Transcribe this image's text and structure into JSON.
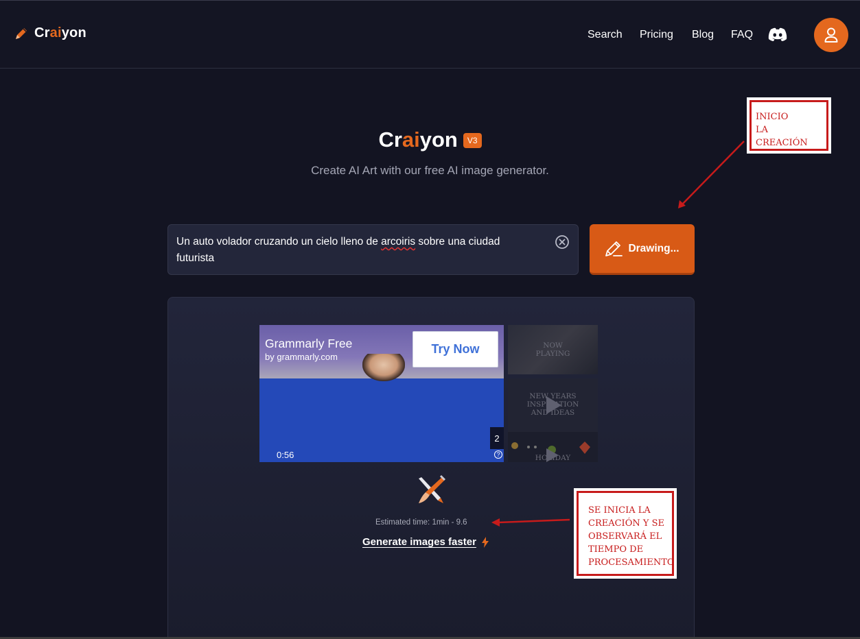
{
  "header": {
    "logo": {
      "prefix": "Cr",
      "highlight": "ai",
      "suffix": "yon"
    },
    "nav": [
      "Search",
      "Pricing",
      "Blog",
      "FAQ"
    ]
  },
  "hero": {
    "title": {
      "prefix": "Cr",
      "highlight": "ai",
      "suffix": "yon"
    },
    "badge": "V3",
    "subtitle": "Create AI Art with our free AI image generator."
  },
  "prompt": {
    "text_before": "Un auto volador cruzando un cielo lleno de ",
    "misspelled": "arcoiris",
    "text_after": " sobre una ciudad futurista"
  },
  "draw_button": {
    "label": "Drawing..."
  },
  "ad": {
    "title": "Grammarly Free",
    "sub": "by grammarly.com",
    "cta": "Try Now",
    "time": "0:56",
    "count": "2",
    "help": "?",
    "thumbs": {
      "now_playing": "NOW\nPLAYING",
      "new_years": "NEW YEARS\nINSPIRATION\nAND IDEAS",
      "holiday": "HOLIDAY"
    }
  },
  "progress": {
    "estimate": "Estimated time: 1min - 9.6",
    "faster_link": "Generate images faster"
  },
  "annotations": {
    "note1": "INICIO\nLA CREACIÓN",
    "note2": "SE INICIA LA\nCREACIÓN Y SE\nOBSERVARÁ EL\nTIEMPO DE\nPROCESAMIENTO"
  },
  "colors": {
    "accent": "#e4681e",
    "annotation": "#c71b1b",
    "background": "#131422"
  }
}
